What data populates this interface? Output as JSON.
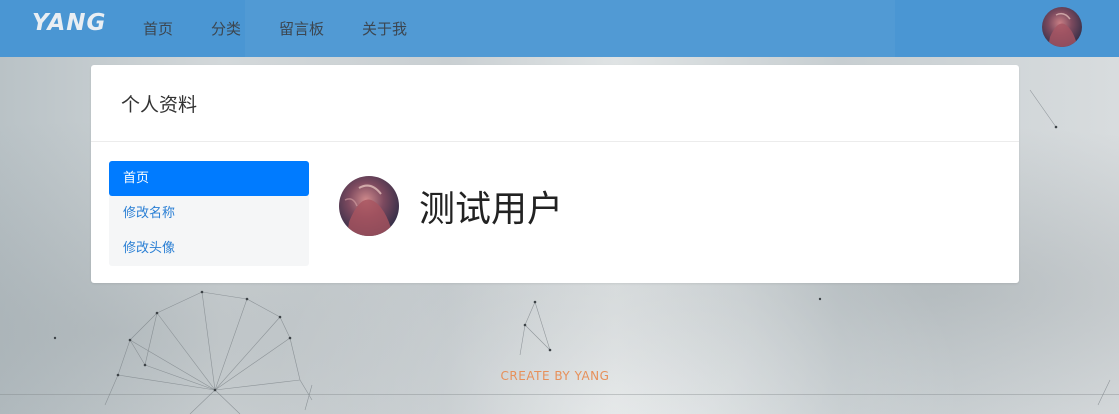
{
  "navbar": {
    "brand": "YANG",
    "links": [
      "首页",
      "分类",
      "留言板",
      "关于我"
    ],
    "avatar_icon": "user-avatar-icon"
  },
  "card": {
    "title": "个人资料",
    "menu": [
      {
        "label": "首页",
        "active": true
      },
      {
        "label": "修改名称",
        "active": false
      },
      {
        "label": "修改头像",
        "active": false
      }
    ],
    "profile": {
      "username": "测试用户"
    }
  },
  "footer": {
    "text": "CREATE BY YANG"
  },
  "colors": {
    "navbar_bg": "#4a96d3",
    "active_menu": "#007bff",
    "menu_link": "#2a7fd4",
    "footer_text": "#e7905a"
  }
}
